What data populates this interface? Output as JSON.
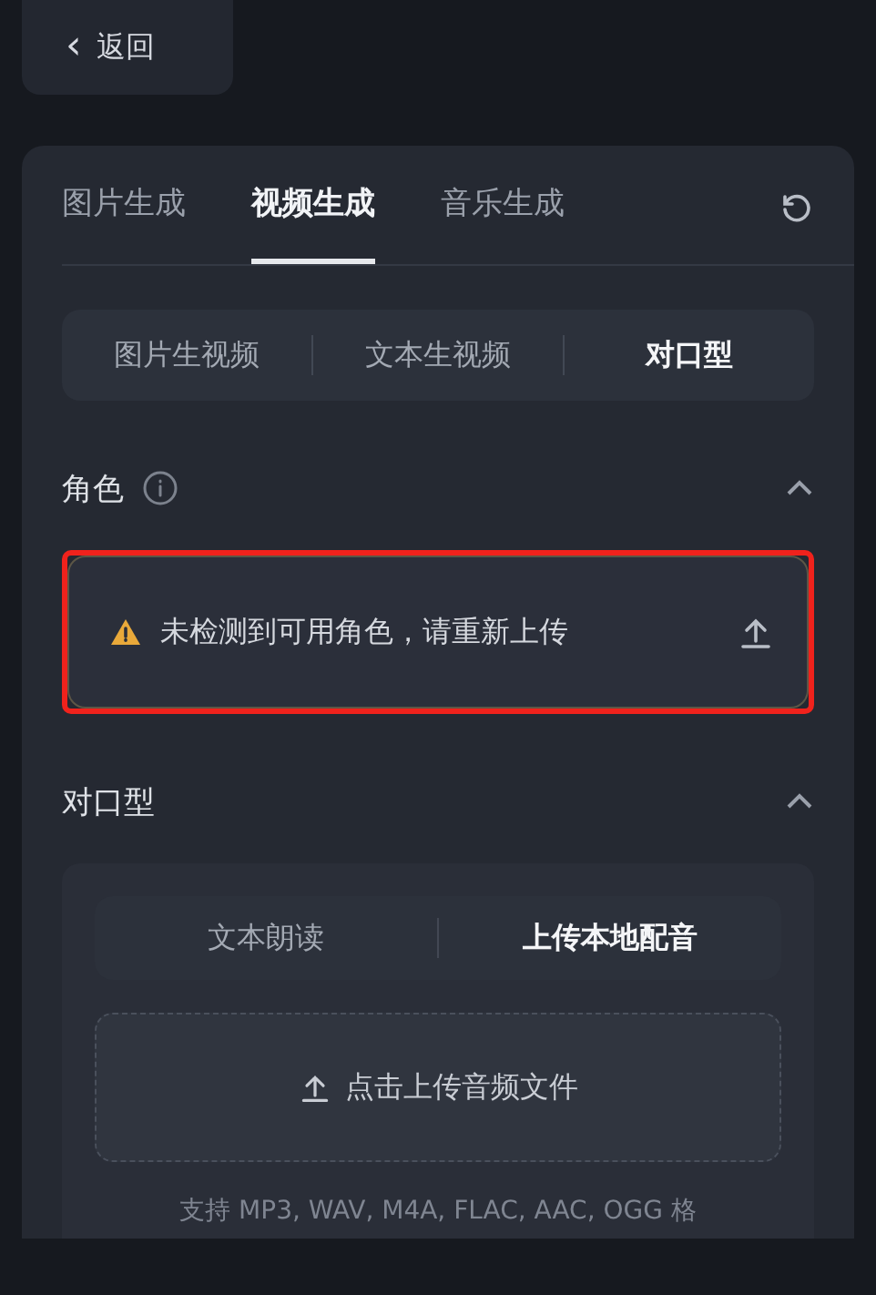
{
  "back_button": {
    "icon": "‹",
    "label": "返回"
  },
  "tabs": [
    {
      "label": "图片生成",
      "selected": false
    },
    {
      "label": "视频生成",
      "selected": true
    },
    {
      "label": "音乐生成",
      "selected": false
    }
  ],
  "modes": [
    {
      "label": "图片生视频",
      "selected": false
    },
    {
      "label": "文本生视频",
      "selected": false
    },
    {
      "label": "对口型",
      "selected": true
    }
  ],
  "character_section": {
    "title": "角色",
    "expanded": true,
    "alert": {
      "message": "未检测到可用角色，请重新上传",
      "highlighted": true
    }
  },
  "lipsync_section": {
    "title": "对口型",
    "expanded": true,
    "sources": [
      {
        "label": "文本朗读",
        "selected": false
      },
      {
        "label": "上传本地配音",
        "selected": true
      }
    ],
    "upload_label": "点击上传音频文件",
    "formats_note": "支持 MP3, WAV, M4A, FLAC, AAC, OGG 格"
  }
}
